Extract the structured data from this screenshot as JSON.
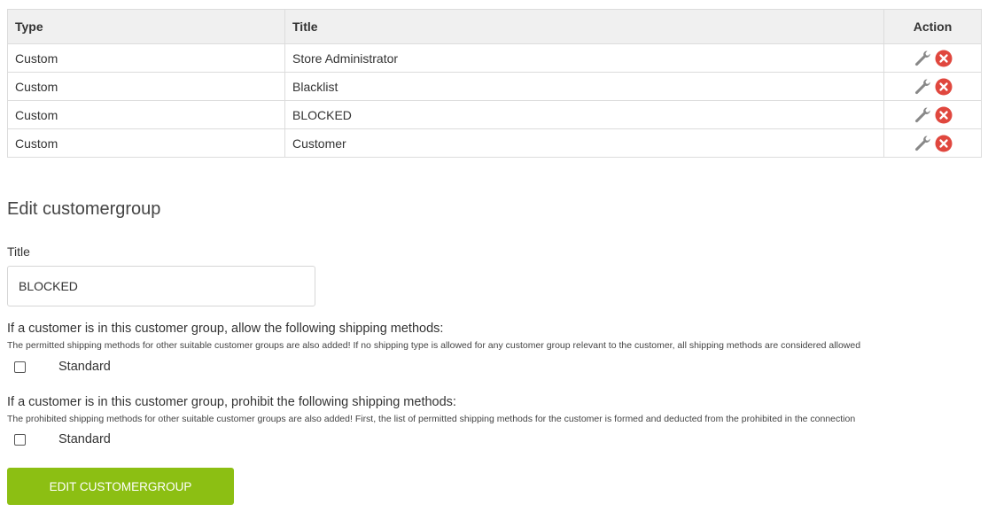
{
  "table": {
    "headers": {
      "type": "Type",
      "title": "Title",
      "action": "Action"
    },
    "rows": [
      {
        "type": "Custom",
        "title": "Store Administrator"
      },
      {
        "type": "Custom",
        "title": "Blacklist"
      },
      {
        "type": "Custom",
        "title": "BLOCKED"
      },
      {
        "type": "Custom",
        "title": "Customer"
      }
    ],
    "icons": {
      "edit": "wrench-icon",
      "delete": "delete-circle-x-icon"
    },
    "colors": {
      "delete": "#e0473e",
      "wrench": "#888888"
    }
  },
  "form": {
    "heading": "Edit customergroup",
    "title_label": "Title",
    "title_value": "BLOCKED",
    "allow": {
      "question": "If a customer is in this customer group, allow the following shipping methods:",
      "note": "The permitted shipping methods for other suitable customer groups are also added! If no shipping type is allowed for any customer group relevant to the customer, all shipping methods are considered allowed",
      "option_label": "Standard",
      "checked": false
    },
    "prohibit": {
      "question": "If a customer is in this customer group, prohibit the following shipping methods:",
      "note": "The prohibited shipping methods for other suitable customer groups are also added! First, the list of permitted shipping methods for the customer is formed and deducted from the prohibited in the connection",
      "option_label": "Standard",
      "checked": false
    },
    "submit_label": "EDIT CUSTOMERGROUP",
    "submit_color": "#8cbf13"
  }
}
